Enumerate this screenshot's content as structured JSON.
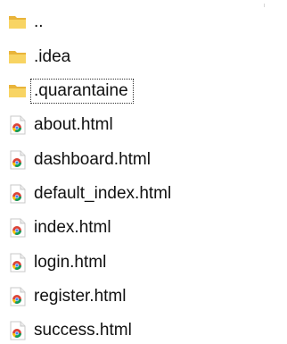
{
  "colors": {
    "folder_back": "#e9b43a",
    "folder_front": "#f8d463",
    "chrome_red": "#db4437",
    "chrome_yellow": "#f4c20d",
    "chrome_green": "#0f9d58",
    "chrome_blue": "#4285f4",
    "text": "#111111",
    "focus_outline": "#333333"
  },
  "entries": [
    {
      "name": "..",
      "type": "folder",
      "icon": "folder-icon"
    },
    {
      "name": ".idea",
      "type": "folder",
      "icon": "folder-icon"
    },
    {
      "name": ".quarantaine",
      "type": "folder",
      "icon": "folder-icon",
      "focused": true
    },
    {
      "name": "about.html",
      "type": "html",
      "icon": "chrome-html-file-icon"
    },
    {
      "name": "dashboard.html",
      "type": "html",
      "icon": "chrome-html-file-icon"
    },
    {
      "name": "default_index.html",
      "type": "html",
      "icon": "chrome-html-file-icon"
    },
    {
      "name": "index.html",
      "type": "html",
      "icon": "chrome-html-file-icon"
    },
    {
      "name": "login.html",
      "type": "html",
      "icon": "chrome-html-file-icon"
    },
    {
      "name": "register.html",
      "type": "html",
      "icon": "chrome-html-file-icon"
    },
    {
      "name": "success.html",
      "type": "html",
      "icon": "chrome-html-file-icon"
    }
  ]
}
